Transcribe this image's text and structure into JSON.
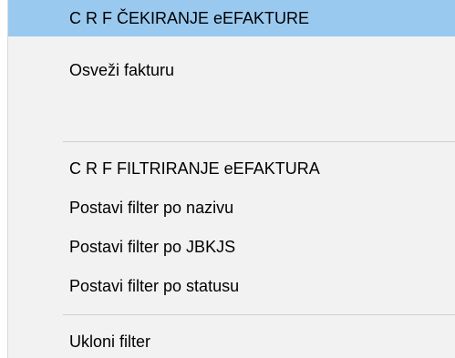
{
  "menu": {
    "items": [
      {
        "label": "C R F  ČEKIRANJE eEFAKTURE",
        "highlighted": true
      },
      {
        "label": "Osveži fakturu"
      },
      {
        "label": ""
      },
      {
        "label": "C R F  FILTRIRANJE eEFAKTURA"
      },
      {
        "label": "Postavi filter po nazivu"
      },
      {
        "label": "Postavi filter po JBKJS"
      },
      {
        "label": "Postavi filter po statusu"
      },
      {
        "label": "Ukloni filter"
      }
    ]
  },
  "colors": {
    "highlight": "#99c9ef",
    "menu_background": "#f2f2f2",
    "separator": "#cfcfcf"
  }
}
